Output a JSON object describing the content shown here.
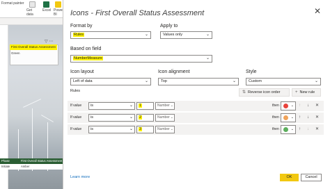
{
  "background": {
    "ribbon": {
      "format_painter": "Format painter",
      "get_data": "Get data",
      "excel": "Excel",
      "power_bi": "Power BI"
    },
    "visual": {
      "header": "First Overall Status Assessment",
      "cell": "Green"
    },
    "table": {
      "col1": "Phase",
      "col2": "First Overall Status Assessment",
      "row_col1": "Initiate",
      "row_col2": "Amber"
    }
  },
  "dialog": {
    "title": "Icons - First Overall Status Assessment",
    "format_by_label": "Format by",
    "format_by_value": "Rules",
    "apply_to_label": "Apply to",
    "apply_to_value": "Values only",
    "based_on_label": "Based on field",
    "based_on_value": "NumberMeasure",
    "icon_layout_label": "Icon layout",
    "icon_layout_value": "Left of data",
    "icon_alignment_label": "Icon alignment",
    "icon_alignment_value": "Top",
    "style_label": "Style",
    "style_value": "Custom",
    "rules_label": "Rules",
    "reverse_button": "Reverse icon order",
    "new_rule_button": "New rule",
    "learn_more": "Learn more",
    "ok": "OK",
    "cancel": "Cancel"
  },
  "rules": [
    {
      "if_value": "If value",
      "operator": "is",
      "value": "1",
      "type": "Number",
      "then": "then",
      "icon_color": "#e8433b"
    },
    {
      "if_value": "If value",
      "operator": "is",
      "value": "2",
      "type": "Number",
      "then": "then",
      "icon_color": "#f0a35a"
    },
    {
      "if_value": "If value",
      "operator": "is",
      "value": "3",
      "type": "Number",
      "then": "then",
      "icon_color": "#5cae5c"
    }
  ],
  "colors": {
    "highlight": "#fff200",
    "ok_button": "#f2c811",
    "link": "#0f6cbd",
    "table_header": "#2a5d33"
  }
}
